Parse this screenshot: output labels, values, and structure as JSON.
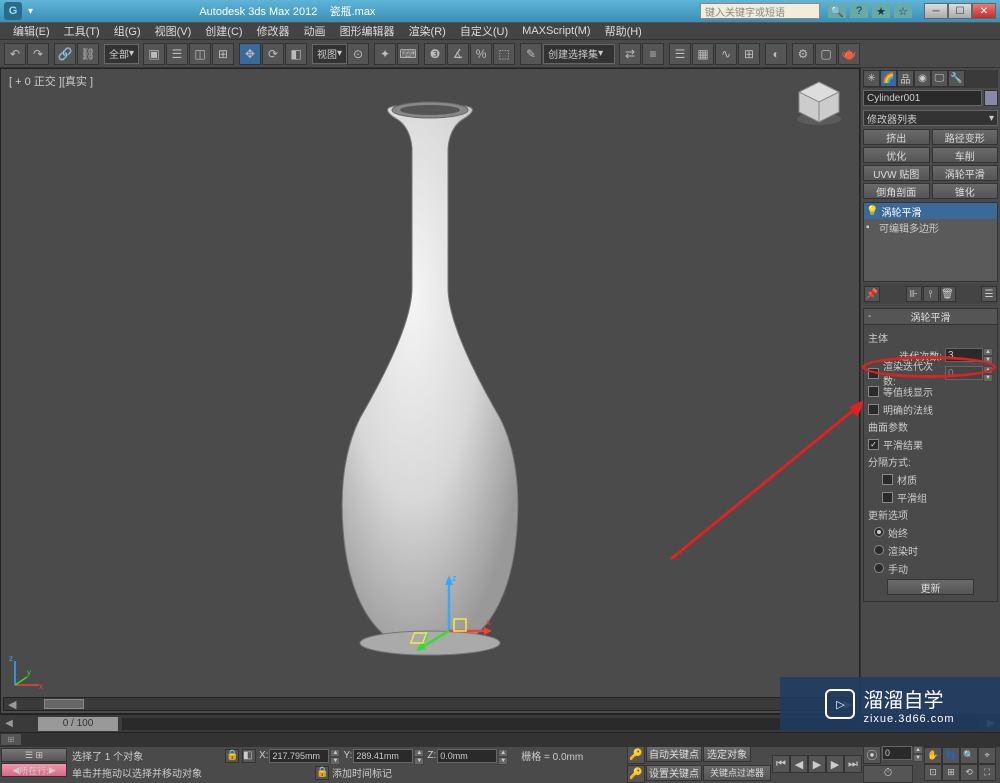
{
  "title_bar": {
    "app_title": "Autodesk 3ds Max  2012",
    "file_name": "瓷瓶.max",
    "search_placeholder": "键入关键字或短语"
  },
  "menus": [
    "编辑(E)",
    "工具(T)",
    "组(G)",
    "视图(V)",
    "创建(C)",
    "修改器",
    "动画",
    "图形编辑器",
    "渲染(R)",
    "自定义(U)",
    "MAXScript(M)",
    "帮助(H)"
  ],
  "toolbar": {
    "all_filter": "全部",
    "view_dropdown": "视图",
    "selset_label": "创建选择集"
  },
  "viewport": {
    "label": "[ + 0 正交 ][真实 ]",
    "slider_label": "0 / 100"
  },
  "right_panel": {
    "object_name": "Cylinder001",
    "modlist_label": "修改器列表",
    "buttons": {
      "b1": "挤出",
      "b2": "路径变形",
      "b3": "优化",
      "b4": "车削",
      "b5": "UVW 贴图",
      "b6": "涡轮平滑",
      "b7": "倒角剖面",
      "b8": "锥化"
    },
    "stack": {
      "item1": "涡轮平滑",
      "item2": "可编辑多边形"
    },
    "rollout_title": "涡轮平滑",
    "params": {
      "main_group": "主体",
      "iterations_label": "迭代次数:",
      "iterations_value": "3",
      "render_iters_label": "渲染迭代次数:",
      "render_iters_value": "0",
      "isoline_label": "等值线显示",
      "explicit_label": "明确的法线",
      "surface_group": "曲面参数",
      "smooth_result": "平滑结果",
      "separate_by": "分隔方式:",
      "material_label": "材质",
      "smooth_group_label": "平滑组",
      "update_group": "更新选项",
      "always": "始终",
      "render": "渲染时",
      "manual": "手动",
      "update_btn": "更新"
    }
  },
  "status": {
    "selected": "选择了 1 个对象",
    "hint": "单击并拖动以选择并移动对象",
    "x_val": "217.795mm",
    "y_val": "289.41mm",
    "z_val": "0.0mm",
    "grid_label": "栅格 = 0.0mm",
    "autokey": "自动关键点",
    "selset": "选定对象",
    "setkey": "设置关键点",
    "keyfilter": "关键点过滤器",
    "addtime": "添加时间标记",
    "row_label": "所在行:"
  },
  "watermark": {
    "brand": "溜溜自学",
    "url": "zixue.3d66.com"
  }
}
